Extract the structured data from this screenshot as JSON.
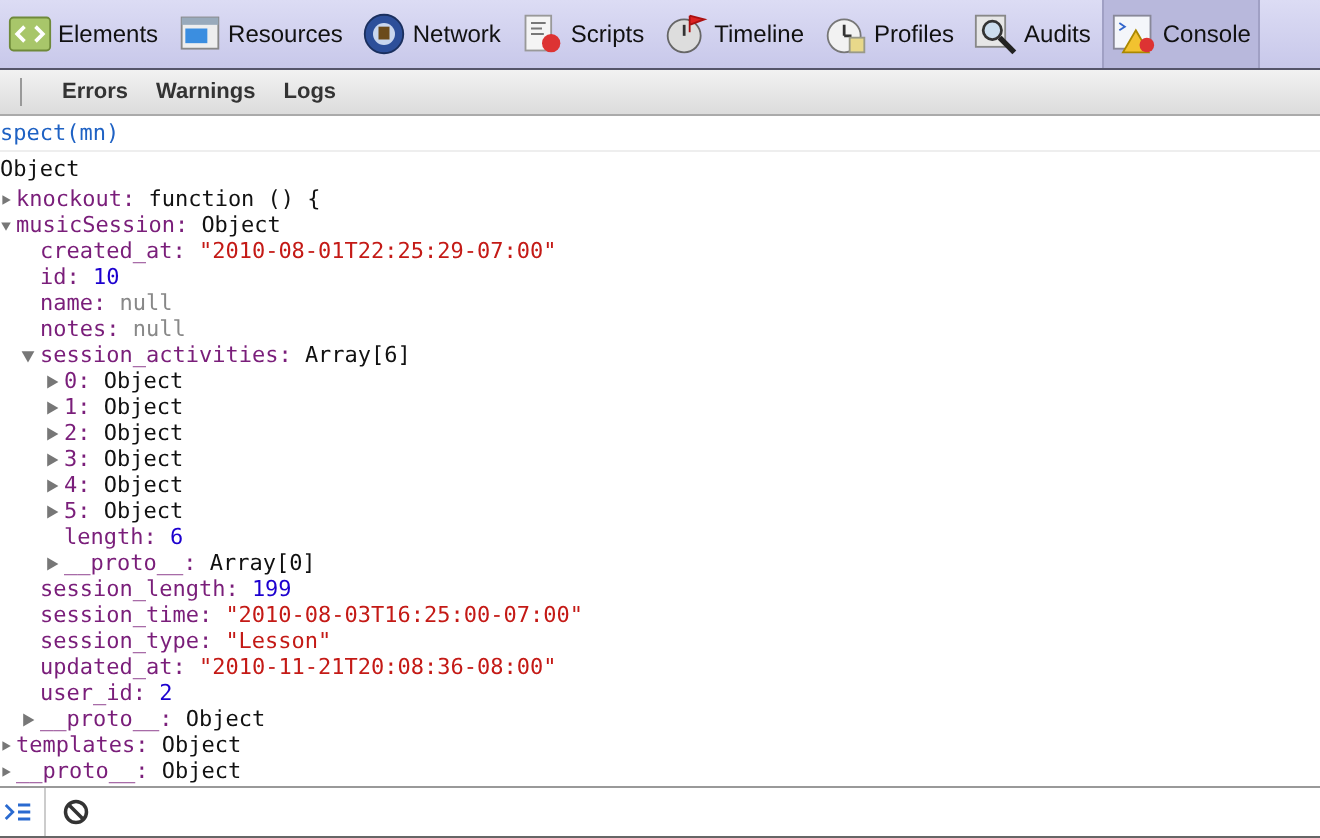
{
  "toolbar": {
    "tabs": [
      {
        "label": "Elements",
        "selected": false
      },
      {
        "label": "Resources",
        "selected": false
      },
      {
        "label": "Network",
        "selected": false
      },
      {
        "label": "Scripts",
        "selected": false
      },
      {
        "label": "Timeline",
        "selected": false
      },
      {
        "label": "Profiles",
        "selected": false
      },
      {
        "label": "Audits",
        "selected": false
      },
      {
        "label": "Console",
        "selected": true
      }
    ]
  },
  "filter_bar": {
    "filters": [
      {
        "label": "Errors"
      },
      {
        "label": "Warnings"
      },
      {
        "label": "Logs"
      }
    ]
  },
  "console": {
    "command": "spect(mn)",
    "result": "Object",
    "tree": [
      {
        "key": "knockout:",
        "value": "function () {",
        "kind": "object",
        "expanded": false
      },
      {
        "key": "musicSession:",
        "value": "Object",
        "kind": "object",
        "expanded": true,
        "children": [
          {
            "key": "created_at:",
            "value": "\"2010-08-01T22:25:29-07:00\"",
            "kind": "string"
          },
          {
            "key": "id:",
            "value": "10",
            "kind": "number"
          },
          {
            "key": "name:",
            "value": "null",
            "kind": "null"
          },
          {
            "key": "notes:",
            "value": "null",
            "kind": "null"
          },
          {
            "key": "session_activities:",
            "value": "Array[6]",
            "kind": "object",
            "expanded": true,
            "children": [
              {
                "key": "0:",
                "value": "Object",
                "kind": "object",
                "expanded": false
              },
              {
                "key": "1:",
                "value": "Object",
                "kind": "object",
                "expanded": false
              },
              {
                "key": "2:",
                "value": "Object",
                "kind": "object",
                "expanded": false
              },
              {
                "key": "3:",
                "value": "Object",
                "kind": "object",
                "expanded": false
              },
              {
                "key": "4:",
                "value": "Object",
                "kind": "object",
                "expanded": false
              },
              {
                "key": "5:",
                "value": "Object",
                "kind": "object",
                "expanded": false
              },
              {
                "key": "length:",
                "value": "6",
                "kind": "number"
              },
              {
                "key": "__proto__:",
                "value": "Array[0]",
                "kind": "object",
                "expanded": false
              }
            ]
          },
          {
            "key": "session_length:",
            "value": "199",
            "kind": "number"
          },
          {
            "key": "session_time:",
            "value": "\"2010-08-03T16:25:00-07:00\"",
            "kind": "string"
          },
          {
            "key": "session_type:",
            "value": "\"Lesson\"",
            "kind": "string"
          },
          {
            "key": "updated_at:",
            "value": "\"2010-11-21T20:08:36-08:00\"",
            "kind": "string"
          },
          {
            "key": "user_id:",
            "value": "2",
            "kind": "number"
          },
          {
            "key": "__proto__:",
            "value": "Object",
            "kind": "object",
            "expanded": false
          }
        ]
      },
      {
        "key": "templates:",
        "value": "Object",
        "kind": "object",
        "expanded": false
      },
      {
        "key": "__proto__:",
        "value": "Object",
        "kind": "object",
        "expanded": false
      }
    ]
  }
}
